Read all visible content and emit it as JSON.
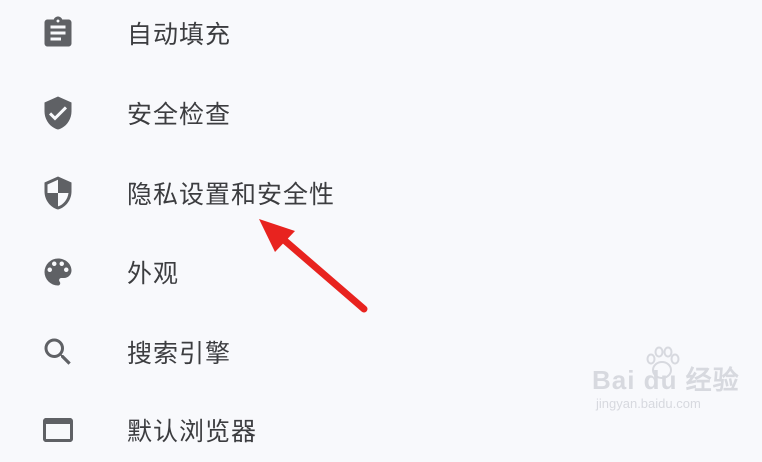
{
  "menu": {
    "items": [
      {
        "label": "自动填充",
        "icon": "clipboard-icon"
      },
      {
        "label": "安全检查",
        "icon": "shield-check-icon"
      },
      {
        "label": "隐私设置和安全性",
        "icon": "shield-half-icon"
      },
      {
        "label": "外观",
        "icon": "palette-icon"
      },
      {
        "label": "搜索引擎",
        "icon": "search-icon"
      },
      {
        "label": "默认浏览器",
        "icon": "browser-icon"
      }
    ]
  },
  "watermark": {
    "brand": "Bai du 经验",
    "url": "jingyan.baidu.com"
  },
  "colors": {
    "icon": "#5f6165",
    "text": "#3c3d40",
    "arrow": "#e8231f",
    "background": "#f8f9fc"
  }
}
